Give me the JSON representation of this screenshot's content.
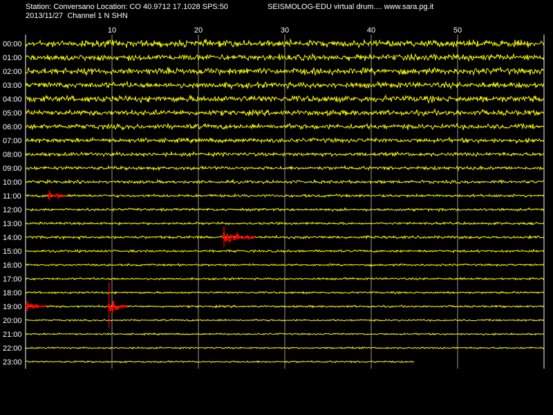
{
  "header": {
    "station_line": "Station: Conversano Location: CO 40.9712 17.1028 SPS:50",
    "date_line": "2013/11/27  Channel 1 N SHN",
    "app_line": "SEISMOLOG-EDU virtual drum.... www.sara.pg.it"
  },
  "colors": {
    "background": "#000000",
    "trace": "#ffff00",
    "event": "#ff0000",
    "grid": "#ffffff",
    "text": "#ffffff"
  },
  "chart_data": {
    "type": "line",
    "title": "",
    "x_unit": "minute",
    "xlim": [
      0,
      60
    ],
    "x_ticks": [
      10,
      20,
      30,
      40,
      50
    ],
    "rows": [
      "00:00",
      "01:00",
      "02:00",
      "03:00",
      "04:00",
      "05:00",
      "06:00",
      "07:00",
      "08:00",
      "09:00",
      "10:00",
      "11:00",
      "12:00",
      "13:00",
      "14:00",
      "15:00",
      "16:00",
      "17:00",
      "18:00",
      "19:00",
      "20:00",
      "21:00",
      "22:00",
      "23:00"
    ],
    "last_row_end_minute": 45,
    "noise_level": [
      1.0,
      0.9,
      0.95,
      0.85,
      0.95,
      0.8,
      0.75,
      0.65,
      0.55,
      0.5,
      0.45,
      0.4,
      0.38,
      0.35,
      0.4,
      0.35,
      0.3,
      0.3,
      0.3,
      0.3,
      0.25,
      0.25,
      0.25,
      0.25
    ],
    "events": [
      {
        "row": "11:00",
        "start_minute": 2.6,
        "end_minute": 4.6,
        "peak": 0.8
      },
      {
        "row": "14:00",
        "start_minute": 22.8,
        "end_minute": 26.6,
        "peak": 1.6
      },
      {
        "row": "19:00",
        "start_minute": 0.0,
        "end_minute": 2.4,
        "peak": 0.8
      },
      {
        "row": "19:00",
        "start_minute": 9.5,
        "end_minute": 11.8,
        "peak": 3.5
      }
    ]
  }
}
